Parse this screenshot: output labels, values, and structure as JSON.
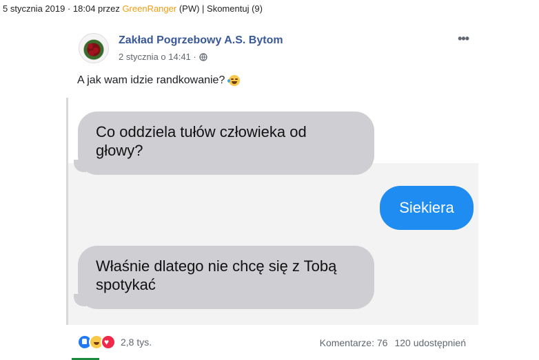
{
  "meta": {
    "date": "5 stycznia 2019 · 18:04 przez ",
    "user": "GreenRanger",
    "pw": " (PW) | ",
    "comment_link": "Skomentuj (9)"
  },
  "post": {
    "page_name": "Zakład Pogrzebowy A.S. Bytom",
    "time": "2 stycznia o 14:41 ·",
    "text": "A jak wam idzie randkowanie?",
    "more": "•••"
  },
  "chat": {
    "message_1": "Co oddziela tułów człowieka od głowy?",
    "reply": "Siekiera",
    "message_2": "Właśnie dlatego nie chcę się z Tobą spotykać"
  },
  "footer": {
    "reactions_count": "2,8 tys.",
    "comments": "Komentarze: 76",
    "shares": "120 udostępnień"
  }
}
